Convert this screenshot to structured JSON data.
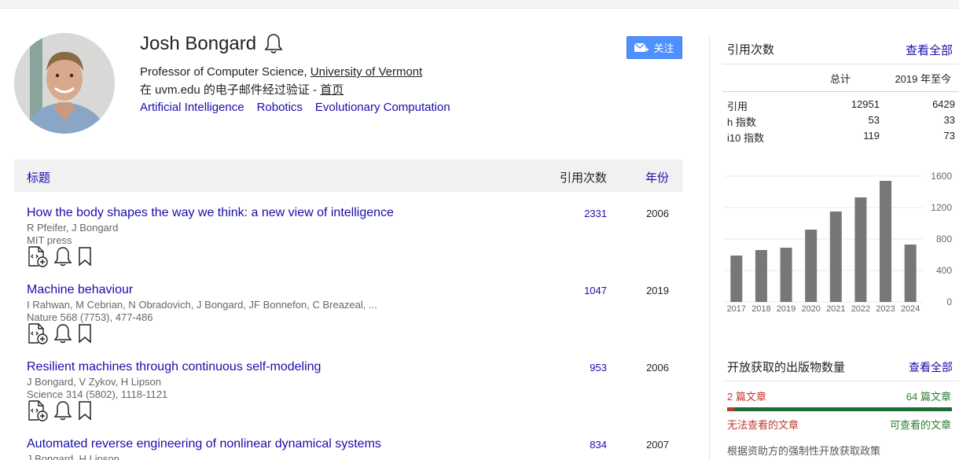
{
  "profile": {
    "name": "Josh Bongard",
    "affiliation_prefix": "Professor of Computer Science, ",
    "affiliation_link": "University of Vermont",
    "verified_text": "在 uvm.edu 的电子邮件经过验证 - ",
    "homepage_label": "首页",
    "interests": [
      "Artificial Intelligence",
      "Robotics",
      "Evolutionary Computation"
    ],
    "follow_label": "关注"
  },
  "table": {
    "col_title": "标题",
    "col_cites": "引用次数",
    "col_year": "年份",
    "rows": [
      {
        "title": "How the body shapes the way we think: a new view of intelligence",
        "authors": "R Pfeifer, J Bongard",
        "venue": "MIT press",
        "cites": "2331",
        "year": "2006"
      },
      {
        "title": "Machine behaviour",
        "authors": "I Rahwan, M Cebrian, N Obradovich, J Bongard, JF Bonnefon, C Breazeal, ...",
        "venue": "Nature 568 (7753), 477-486",
        "cites": "1047",
        "year": "2019"
      },
      {
        "title": "Resilient machines through continuous self-modeling",
        "authors": "J Bongard, V Zykov, H Lipson",
        "venue": "Science 314 (5802), 1118-1121",
        "cites": "953",
        "year": "2006"
      },
      {
        "title": "Automated reverse engineering of nonlinear dynamical systems",
        "authors": "J Bongard, H Lipson",
        "venue": "",
        "cites": "834",
        "year": "2007"
      }
    ]
  },
  "sidebar": {
    "title": "引用次数",
    "view_all": "查看全部",
    "col_total": "总计",
    "col_since": "2019 年至今",
    "metrics": [
      {
        "label": "引用",
        "total": "12951",
        "since": "6429"
      },
      {
        "label": "h 指数",
        "total": "53",
        "since": "33"
      },
      {
        "label": "i10 指数",
        "total": "119",
        "since": "73"
      }
    ],
    "open_access": {
      "title": "开放获取的出版物数量",
      "view_all": "查看全部",
      "unavailable_count": "2 篇文章",
      "available_count": "64 篇文章",
      "unavailable_label": "无法查看的文章",
      "available_label": "可查看的文章",
      "unavailable_fraction": 0.03,
      "policy_text": "根据资助方的强制性开放获取政策",
      "color_unavailable": "#c0392b",
      "color_available": "#1e6b3a"
    }
  },
  "chart_data": {
    "type": "bar",
    "categories": [
      "2017",
      "2018",
      "2019",
      "2020",
      "2021",
      "2022",
      "2023",
      "2024"
    ],
    "values": [
      590,
      660,
      690,
      920,
      1150,
      1330,
      1540,
      730
    ],
    "ylim": [
      0,
      1600
    ],
    "yticks": [
      "1600",
      "1200",
      "800",
      "400",
      "0"
    ],
    "bar_color": "#777777",
    "grid": true
  }
}
